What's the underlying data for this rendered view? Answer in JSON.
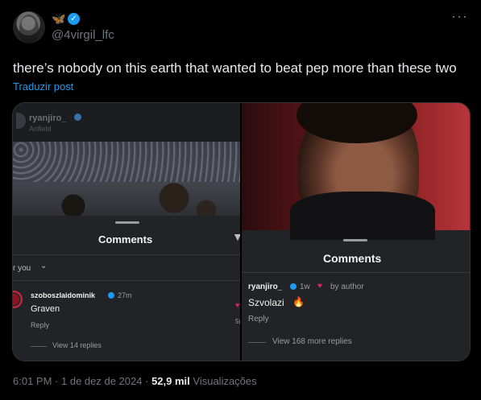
{
  "author": {
    "emoji": "🦋",
    "verified_mark": "✓",
    "handle": "@4virgil_lfc"
  },
  "more_glyph": "···",
  "tweet": {
    "text": "there’s nobody on this earth that wanted to beat pep more than these two",
    "translate_label": "Traduzir post"
  },
  "left_shot": {
    "username": "ryanjiro_",
    "location": "Anfield",
    "comments_title": "Comments",
    "filter_label": "r you",
    "comment": {
      "user": "szoboszlaidominik",
      "time": "27m",
      "text": "Graven",
      "reply": "Reply",
      "view_replies": "View 14 replies",
      "like_count": "5("
    }
  },
  "right_shot": {
    "comments_title": "Comments",
    "comment": {
      "user": "ryanjiro_",
      "time": "1w",
      "by_author": "by author",
      "text": "Szvolazi",
      "emoji": "🔥",
      "reply": "Reply",
      "view_replies": "View 168 more replies"
    }
  },
  "footer": {
    "time": "6:01 PM",
    "date": "1 de dez de 2024",
    "views_count": "52,9 mil",
    "views_label": "Visualizações"
  },
  "colors": {
    "background": "#000000",
    "accent": "#1d9bf0",
    "muted": "#71767b",
    "heart": "#e0245e"
  }
}
